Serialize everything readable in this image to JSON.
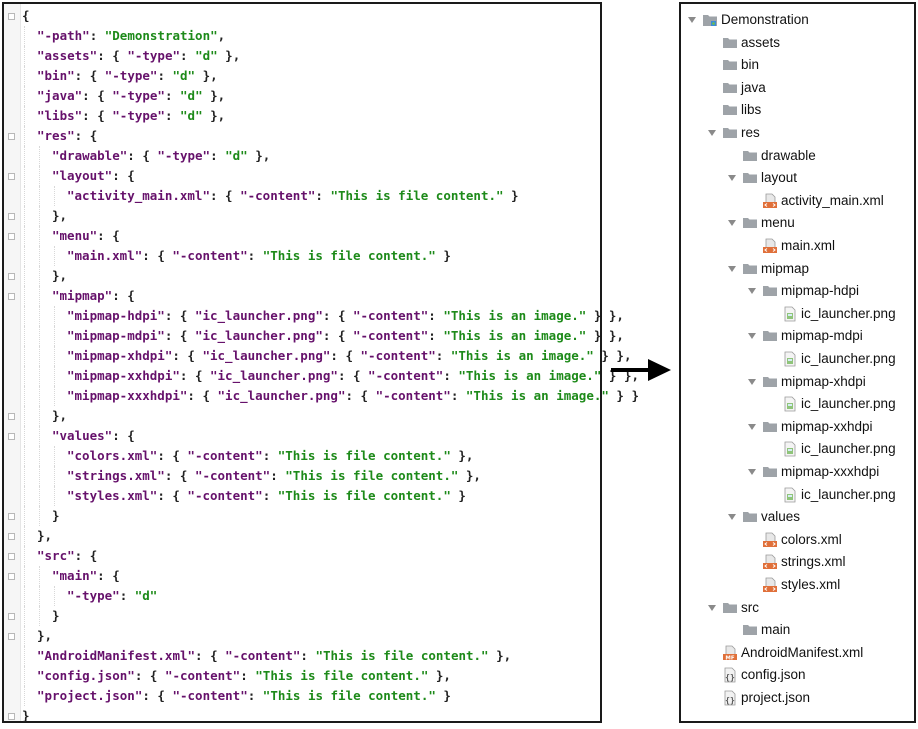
{
  "json_lines": [
    {
      "indent": 0,
      "fold": "open",
      "tokens": [
        {
          "t": "p",
          "v": "{"
        }
      ]
    },
    {
      "indent": 1,
      "tokens": [
        {
          "t": "k",
          "v": "\"-path\""
        },
        {
          "t": "p",
          "v": ": "
        },
        {
          "t": "s",
          "v": "\"Demonstration\""
        },
        {
          "t": "p",
          "v": ","
        }
      ]
    },
    {
      "indent": 1,
      "tokens": [
        {
          "t": "k",
          "v": "\"assets\""
        },
        {
          "t": "p",
          "v": ": { "
        },
        {
          "t": "k",
          "v": "\"-type\""
        },
        {
          "t": "p",
          "v": ": "
        },
        {
          "t": "s",
          "v": "\"d\""
        },
        {
          "t": "p",
          "v": " },"
        }
      ]
    },
    {
      "indent": 1,
      "tokens": [
        {
          "t": "k",
          "v": "\"bin\""
        },
        {
          "t": "p",
          "v": ": { "
        },
        {
          "t": "k",
          "v": "\"-type\""
        },
        {
          "t": "p",
          "v": ": "
        },
        {
          "t": "s",
          "v": "\"d\""
        },
        {
          "t": "p",
          "v": " },"
        }
      ]
    },
    {
      "indent": 1,
      "tokens": [
        {
          "t": "k",
          "v": "\"java\""
        },
        {
          "t": "p",
          "v": ": { "
        },
        {
          "t": "k",
          "v": "\"-type\""
        },
        {
          "t": "p",
          "v": ": "
        },
        {
          "t": "s",
          "v": "\"d\""
        },
        {
          "t": "p",
          "v": " },"
        }
      ]
    },
    {
      "indent": 1,
      "tokens": [
        {
          "t": "k",
          "v": "\"libs\""
        },
        {
          "t": "p",
          "v": ": { "
        },
        {
          "t": "k",
          "v": "\"-type\""
        },
        {
          "t": "p",
          "v": ": "
        },
        {
          "t": "s",
          "v": "\"d\""
        },
        {
          "t": "p",
          "v": " },"
        }
      ]
    },
    {
      "indent": 1,
      "fold": "open",
      "tokens": [
        {
          "t": "k",
          "v": "\"res\""
        },
        {
          "t": "p",
          "v": ": {"
        }
      ]
    },
    {
      "indent": 2,
      "tokens": [
        {
          "t": "k",
          "v": "\"drawable\""
        },
        {
          "t": "p",
          "v": ": { "
        },
        {
          "t": "k",
          "v": "\"-type\""
        },
        {
          "t": "p",
          "v": ": "
        },
        {
          "t": "s",
          "v": "\"d\""
        },
        {
          "t": "p",
          "v": " },"
        }
      ]
    },
    {
      "indent": 2,
      "fold": "open",
      "tokens": [
        {
          "t": "k",
          "v": "\"layout\""
        },
        {
          "t": "p",
          "v": ": {"
        }
      ]
    },
    {
      "indent": 3,
      "tokens": [
        {
          "t": "k",
          "v": "\"activity_main.xml\""
        },
        {
          "t": "p",
          "v": ": { "
        },
        {
          "t": "k",
          "v": "\"-content\""
        },
        {
          "t": "p",
          "v": ": "
        },
        {
          "t": "s",
          "v": "\"This is file content.\""
        },
        {
          "t": "p",
          "v": " }"
        }
      ]
    },
    {
      "indent": 2,
      "fold": "close",
      "tokens": [
        {
          "t": "p",
          "v": "},"
        }
      ]
    },
    {
      "indent": 2,
      "fold": "open",
      "tokens": [
        {
          "t": "k",
          "v": "\"menu\""
        },
        {
          "t": "p",
          "v": ": {"
        }
      ]
    },
    {
      "indent": 3,
      "tokens": [
        {
          "t": "k",
          "v": "\"main.xml\""
        },
        {
          "t": "p",
          "v": ": { "
        },
        {
          "t": "k",
          "v": "\"-content\""
        },
        {
          "t": "p",
          "v": ": "
        },
        {
          "t": "s",
          "v": "\"This is file content.\""
        },
        {
          "t": "p",
          "v": " }"
        }
      ]
    },
    {
      "indent": 2,
      "fold": "close",
      "tokens": [
        {
          "t": "p",
          "v": "},"
        }
      ]
    },
    {
      "indent": 2,
      "fold": "open",
      "tokens": [
        {
          "t": "k",
          "v": "\"mipmap\""
        },
        {
          "t": "p",
          "v": ": {"
        }
      ]
    },
    {
      "indent": 3,
      "tokens": [
        {
          "t": "k",
          "v": "\"mipmap-hdpi\""
        },
        {
          "t": "p",
          "v": ": { "
        },
        {
          "t": "k",
          "v": "\"ic_launcher.png\""
        },
        {
          "t": "p",
          "v": ": { "
        },
        {
          "t": "k",
          "v": "\"-content\""
        },
        {
          "t": "p",
          "v": ": "
        },
        {
          "t": "s",
          "v": "\"This is an image.\""
        },
        {
          "t": "p",
          "v": " } },"
        }
      ]
    },
    {
      "indent": 3,
      "tokens": [
        {
          "t": "k",
          "v": "\"mipmap-mdpi\""
        },
        {
          "t": "p",
          "v": ": { "
        },
        {
          "t": "k",
          "v": "\"ic_launcher.png\""
        },
        {
          "t": "p",
          "v": ": { "
        },
        {
          "t": "k",
          "v": "\"-content\""
        },
        {
          "t": "p",
          "v": ": "
        },
        {
          "t": "s",
          "v": "\"This is an image.\""
        },
        {
          "t": "p",
          "v": " } },"
        }
      ]
    },
    {
      "indent": 3,
      "tokens": [
        {
          "t": "k",
          "v": "\"mipmap-xhdpi\""
        },
        {
          "t": "p",
          "v": ": { "
        },
        {
          "t": "k",
          "v": "\"ic_launcher.png\""
        },
        {
          "t": "p",
          "v": ": { "
        },
        {
          "t": "k",
          "v": "\"-content\""
        },
        {
          "t": "p",
          "v": ": "
        },
        {
          "t": "s",
          "v": "\"This is an image.\""
        },
        {
          "t": "p",
          "v": " } },"
        }
      ]
    },
    {
      "indent": 3,
      "tokens": [
        {
          "t": "k",
          "v": "\"mipmap-xxhdpi\""
        },
        {
          "t": "p",
          "v": ": { "
        },
        {
          "t": "k",
          "v": "\"ic_launcher.png\""
        },
        {
          "t": "p",
          "v": ": { "
        },
        {
          "t": "k",
          "v": "\"-content\""
        },
        {
          "t": "p",
          "v": ": "
        },
        {
          "t": "s",
          "v": "\"This is an image.\""
        },
        {
          "t": "p",
          "v": " } },"
        }
      ]
    },
    {
      "indent": 3,
      "tokens": [
        {
          "t": "k",
          "v": "\"mipmap-xxxhdpi\""
        },
        {
          "t": "p",
          "v": ": { "
        },
        {
          "t": "k",
          "v": "\"ic_launcher.png\""
        },
        {
          "t": "p",
          "v": ": { "
        },
        {
          "t": "k",
          "v": "\"-content\""
        },
        {
          "t": "p",
          "v": ": "
        },
        {
          "t": "s",
          "v": "\"This is an image.\""
        },
        {
          "t": "p",
          "v": " } }"
        }
      ]
    },
    {
      "indent": 2,
      "fold": "close",
      "tokens": [
        {
          "t": "p",
          "v": "},"
        }
      ]
    },
    {
      "indent": 2,
      "fold": "open",
      "tokens": [
        {
          "t": "k",
          "v": "\"values\""
        },
        {
          "t": "p",
          "v": ": {"
        }
      ]
    },
    {
      "indent": 3,
      "tokens": [
        {
          "t": "k",
          "v": "\"colors.xml\""
        },
        {
          "t": "p",
          "v": ": { "
        },
        {
          "t": "k",
          "v": "\"-content\""
        },
        {
          "t": "p",
          "v": ": "
        },
        {
          "t": "s",
          "v": "\"This is file content.\""
        },
        {
          "t": "p",
          "v": " },"
        }
      ]
    },
    {
      "indent": 3,
      "tokens": [
        {
          "t": "k",
          "v": "\"strings.xml\""
        },
        {
          "t": "p",
          "v": ": { "
        },
        {
          "t": "k",
          "v": "\"-content\""
        },
        {
          "t": "p",
          "v": ": "
        },
        {
          "t": "s",
          "v": "\"This is file content.\""
        },
        {
          "t": "p",
          "v": " },"
        }
      ]
    },
    {
      "indent": 3,
      "tokens": [
        {
          "t": "k",
          "v": "\"styles.xml\""
        },
        {
          "t": "p",
          "v": ": { "
        },
        {
          "t": "k",
          "v": "\"-content\""
        },
        {
          "t": "p",
          "v": ": "
        },
        {
          "t": "s",
          "v": "\"This is file content.\""
        },
        {
          "t": "p",
          "v": " }"
        }
      ]
    },
    {
      "indent": 2,
      "fold": "close",
      "tokens": [
        {
          "t": "p",
          "v": "}"
        }
      ]
    },
    {
      "indent": 1,
      "fold": "close",
      "tokens": [
        {
          "t": "p",
          "v": "},"
        }
      ]
    },
    {
      "indent": 1,
      "fold": "open",
      "tokens": [
        {
          "t": "k",
          "v": "\"src\""
        },
        {
          "t": "p",
          "v": ": {"
        }
      ]
    },
    {
      "indent": 2,
      "fold": "open",
      "tokens": [
        {
          "t": "k",
          "v": "\"main\""
        },
        {
          "t": "p",
          "v": ": {"
        }
      ]
    },
    {
      "indent": 3,
      "tokens": [
        {
          "t": "k",
          "v": "\"-type\""
        },
        {
          "t": "p",
          "v": ": "
        },
        {
          "t": "s",
          "v": "\"d\""
        }
      ]
    },
    {
      "indent": 2,
      "fold": "close",
      "tokens": [
        {
          "t": "p",
          "v": "}"
        }
      ]
    },
    {
      "indent": 1,
      "fold": "close",
      "tokens": [
        {
          "t": "p",
          "v": "},"
        }
      ]
    },
    {
      "indent": 1,
      "tokens": [
        {
          "t": "k",
          "v": "\"AndroidManifest.xml\""
        },
        {
          "t": "p",
          "v": ": { "
        },
        {
          "t": "k",
          "v": "\"-content\""
        },
        {
          "t": "p",
          "v": ": "
        },
        {
          "t": "s",
          "v": "\"This is file content.\""
        },
        {
          "t": "p",
          "v": " },"
        }
      ]
    },
    {
      "indent": 1,
      "tokens": [
        {
          "t": "k",
          "v": "\"config.json\""
        },
        {
          "t": "p",
          "v": ": { "
        },
        {
          "t": "k",
          "v": "\"-content\""
        },
        {
          "t": "p",
          "v": ": "
        },
        {
          "t": "s",
          "v": "\"This is file content.\""
        },
        {
          "t": "p",
          "v": " },"
        }
      ]
    },
    {
      "indent": 1,
      "tokens": [
        {
          "t": "k",
          "v": "\"project.json\""
        },
        {
          "t": "p",
          "v": ": { "
        },
        {
          "t": "k",
          "v": "\"-content\""
        },
        {
          "t": "p",
          "v": ": "
        },
        {
          "t": "s",
          "v": "\"This is file content.\""
        },
        {
          "t": "p",
          "v": " }"
        }
      ]
    },
    {
      "indent": 0,
      "fold": "close",
      "tokens": [
        {
          "t": "p",
          "v": "}"
        }
      ]
    }
  ],
  "tree": [
    {
      "depth": 0,
      "label": "Demonstration",
      "icon": "project-folder-icon",
      "expanded": true
    },
    {
      "depth": 1,
      "label": "assets",
      "icon": "folder-icon"
    },
    {
      "depth": 1,
      "label": "bin",
      "icon": "folder-icon"
    },
    {
      "depth": 1,
      "label": "java",
      "icon": "folder-icon"
    },
    {
      "depth": 1,
      "label": "libs",
      "icon": "folder-icon"
    },
    {
      "depth": 1,
      "label": "res",
      "icon": "folder-icon",
      "expanded": true
    },
    {
      "depth": 2,
      "label": "drawable",
      "icon": "folder-icon"
    },
    {
      "depth": 2,
      "label": "layout",
      "icon": "folder-icon",
      "expanded": true
    },
    {
      "depth": 3,
      "label": "activity_main.xml",
      "icon": "xml-file-icon"
    },
    {
      "depth": 2,
      "label": "menu",
      "icon": "folder-icon",
      "expanded": true
    },
    {
      "depth": 3,
      "label": "main.xml",
      "icon": "xml-file-icon"
    },
    {
      "depth": 2,
      "label": "mipmap",
      "icon": "folder-icon",
      "expanded": true
    },
    {
      "depth": 3,
      "label": "mipmap-hdpi",
      "icon": "folder-icon",
      "expanded": true
    },
    {
      "depth": 4,
      "label": "ic_launcher.png",
      "icon": "image-file-icon"
    },
    {
      "depth": 3,
      "label": "mipmap-mdpi",
      "icon": "folder-icon",
      "expanded": true
    },
    {
      "depth": 4,
      "label": "ic_launcher.png",
      "icon": "image-file-icon"
    },
    {
      "depth": 3,
      "label": "mipmap-xhdpi",
      "icon": "folder-icon",
      "expanded": true
    },
    {
      "depth": 4,
      "label": "ic_launcher.png",
      "icon": "image-file-icon"
    },
    {
      "depth": 3,
      "label": "mipmap-xxhdpi",
      "icon": "folder-icon",
      "expanded": true
    },
    {
      "depth": 4,
      "label": "ic_launcher.png",
      "icon": "image-file-icon"
    },
    {
      "depth": 3,
      "label": "mipmap-xxxhdpi",
      "icon": "folder-icon",
      "expanded": true
    },
    {
      "depth": 4,
      "label": "ic_launcher.png",
      "icon": "image-file-icon"
    },
    {
      "depth": 2,
      "label": "values",
      "icon": "folder-icon",
      "expanded": true
    },
    {
      "depth": 3,
      "label": "colors.xml",
      "icon": "xml-file-icon"
    },
    {
      "depth": 3,
      "label": "strings.xml",
      "icon": "xml-file-icon"
    },
    {
      "depth": 3,
      "label": "styles.xml",
      "icon": "xml-file-icon"
    },
    {
      "depth": 1,
      "label": "src",
      "icon": "folder-icon",
      "expanded": true
    },
    {
      "depth": 2,
      "label": "main",
      "icon": "folder-icon"
    },
    {
      "depth": 1,
      "label": "AndroidManifest.xml",
      "icon": "manifest-file-icon"
    },
    {
      "depth": 1,
      "label": "config.json",
      "icon": "json-file-icon"
    },
    {
      "depth": 1,
      "label": "project.json",
      "icon": "json-file-icon"
    }
  ],
  "colors": {
    "json_key": "#66116b",
    "json_string": "#1d8a19",
    "folder": "#9ea3a8",
    "xml_badge": "#e0703a"
  }
}
